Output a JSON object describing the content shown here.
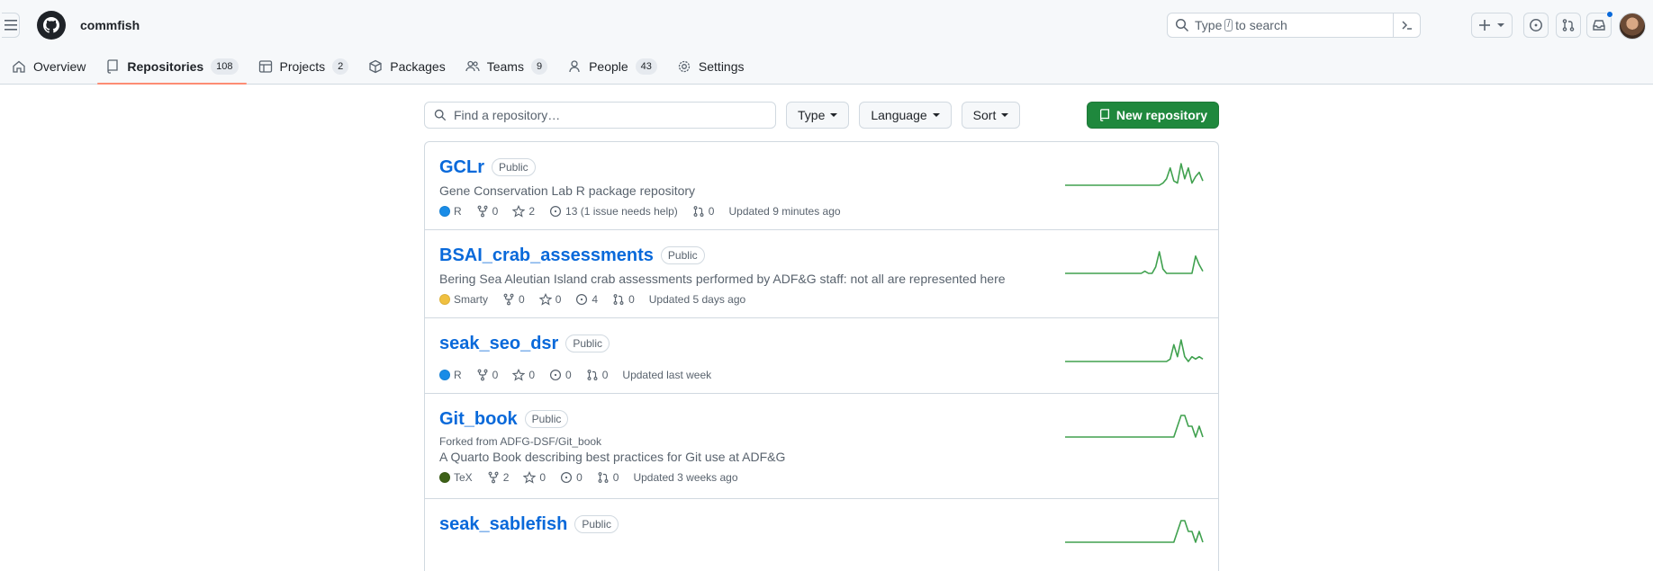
{
  "header": {
    "org_name": "commfish",
    "search": {
      "prefix": "Type",
      "key": "/",
      "suffix": "to search"
    }
  },
  "nav": {
    "tabs": [
      {
        "label": "Overview",
        "icon": "home-icon",
        "count": null
      },
      {
        "label": "Repositories",
        "icon": "repo-icon",
        "count": "108",
        "active": true
      },
      {
        "label": "Projects",
        "icon": "table-icon",
        "count": "2"
      },
      {
        "label": "Packages",
        "icon": "package-icon",
        "count": null
      },
      {
        "label": "Teams",
        "icon": "people-icon",
        "count": "9"
      },
      {
        "label": "People",
        "icon": "person-icon",
        "count": "43"
      },
      {
        "label": "Settings",
        "icon": "gear-icon",
        "count": null
      }
    ]
  },
  "filters": {
    "find_placeholder": "Find a repository…",
    "type_label": "Type",
    "language_label": "Language",
    "sort_label": "Sort",
    "new_repo_label": "New repository"
  },
  "repos": [
    {
      "name": "GCLr",
      "visibility": "Public",
      "desc": "Gene Conservation Lab R package repository",
      "lang": "R",
      "lang_color": "#198CE7",
      "forks": "0",
      "stars": "2",
      "issues": "13 (1 issue needs help)",
      "prs": "0",
      "updated": "Updated 9 minutes ago",
      "spark": [
        0,
        0,
        0,
        0,
        0,
        0,
        0,
        0,
        0,
        0,
        0,
        0,
        0,
        0,
        0,
        0,
        0,
        0,
        0,
        0,
        0,
        0,
        0,
        0,
        0,
        0,
        0,
        1,
        3,
        8,
        2,
        1,
        10,
        3,
        8,
        1,
        4,
        6,
        2
      ]
    },
    {
      "name": "BSAI_crab_assessments",
      "visibility": "Public",
      "desc": "Bering Sea Aleutian Island crab assessments performed by ADF&G staff: not all are represented here",
      "lang": "Smarty",
      "lang_color": "#f0c040",
      "forks": "0",
      "stars": "0",
      "issues": "4",
      "prs": "0",
      "updated": "Updated 5 days ago",
      "spark": [
        0,
        0,
        0,
        0,
        0,
        0,
        0,
        0,
        0,
        0,
        0,
        0,
        0,
        0,
        0,
        0,
        0,
        0,
        0,
        0,
        0,
        0,
        1,
        0,
        0,
        3,
        10,
        2,
        0,
        0,
        0,
        0,
        0,
        0,
        0,
        0,
        8,
        4,
        1
      ]
    },
    {
      "name": "seak_seo_dsr",
      "visibility": "Public",
      "lang": "R",
      "lang_color": "#198CE7",
      "forks": "0",
      "stars": "0",
      "issues": "0",
      "prs": "0",
      "updated": "Updated last week",
      "spark": [
        0,
        0,
        0,
        0,
        0,
        0,
        0,
        0,
        0,
        0,
        0,
        0,
        0,
        0,
        0,
        0,
        0,
        0,
        0,
        0,
        0,
        0,
        0,
        0,
        0,
        0,
        0,
        0,
        0,
        1,
        7,
        2,
        9,
        2,
        0,
        2,
        1,
        2,
        1
      ]
    },
    {
      "name": "Git_book",
      "visibility": "Public",
      "forked_from": "Forked from ADFG-DSF/Git_book",
      "desc": "A Quarto Book describing best practices for Git use at ADF&G",
      "lang": "TeX",
      "lang_color": "#3D6117",
      "forks": "2",
      "stars": "0",
      "issues": "0",
      "prs": "0",
      "updated": "Updated 3 weeks ago",
      "spark": [
        0,
        0,
        0,
        0,
        0,
        0,
        0,
        0,
        0,
        0,
        0,
        0,
        0,
        0,
        0,
        0,
        0,
        0,
        0,
        0,
        0,
        0,
        0,
        0,
        0,
        0,
        0,
        0,
        0,
        0,
        0,
        1,
        2,
        2,
        1,
        1,
        0,
        1,
        0
      ]
    },
    {
      "name": "seak_sablefish",
      "visibility": "Public",
      "spark": [
        0,
        0,
        0,
        0,
        0,
        0,
        0,
        0,
        0,
        0,
        0,
        0,
        0,
        0,
        0,
        0,
        0,
        0,
        0,
        0,
        0,
        0,
        0,
        0,
        0,
        0,
        0,
        0,
        0,
        0,
        0,
        1,
        2,
        2,
        1,
        1,
        0,
        1,
        0
      ]
    }
  ]
}
